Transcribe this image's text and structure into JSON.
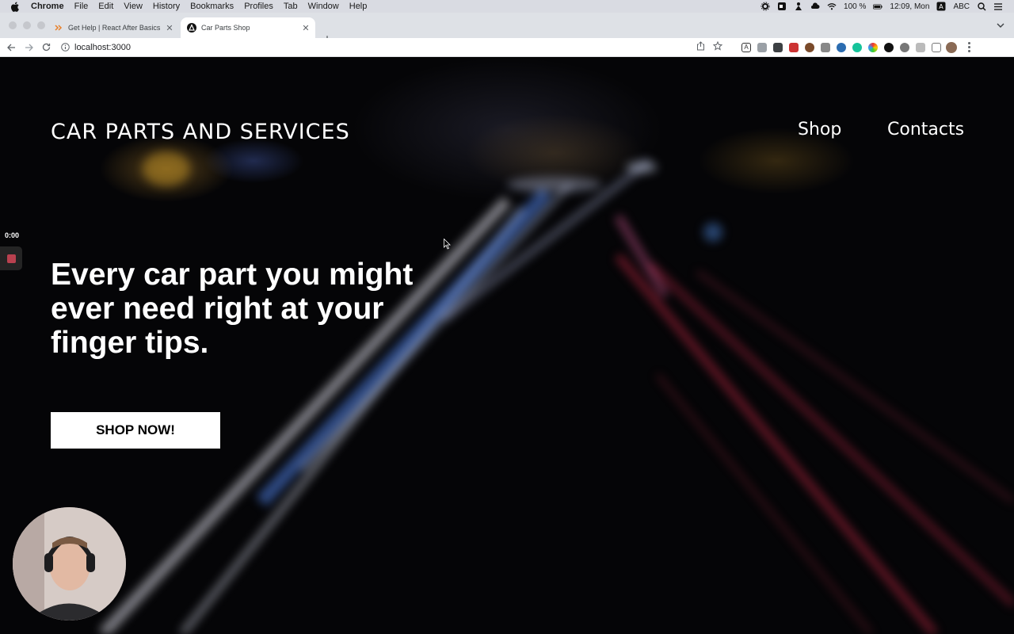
{
  "menubar": {
    "app": "Chrome",
    "items": [
      "File",
      "Edit",
      "View",
      "History",
      "Bookmarks",
      "Profiles",
      "Tab",
      "Window",
      "Help"
    ],
    "battery": "100 %",
    "clock": "12:09, Mon",
    "input_source": "ABC"
  },
  "tabs": [
    {
      "title": "Get Help | React After Basics",
      "icon": "chevrons-icon",
      "active": false
    },
    {
      "title": "Car Parts Shop",
      "icon": "site-favicon-icon",
      "active": true
    }
  ],
  "toolbar": {
    "url": "localhost:3000"
  },
  "page": {
    "brand": "CAR PARTS AND SERVICES",
    "nav": {
      "shop": "Shop",
      "contacts": "Contacts"
    },
    "headline": "Every car part you might ever need right at your finger tips.",
    "cta": "SHOP NOW!"
  },
  "recorder": {
    "timer": "0:00"
  },
  "colors": {
    "accent_button": "#ffffff",
    "text": "#ffffff",
    "background": "#050507",
    "record_red": "#b9414f"
  }
}
